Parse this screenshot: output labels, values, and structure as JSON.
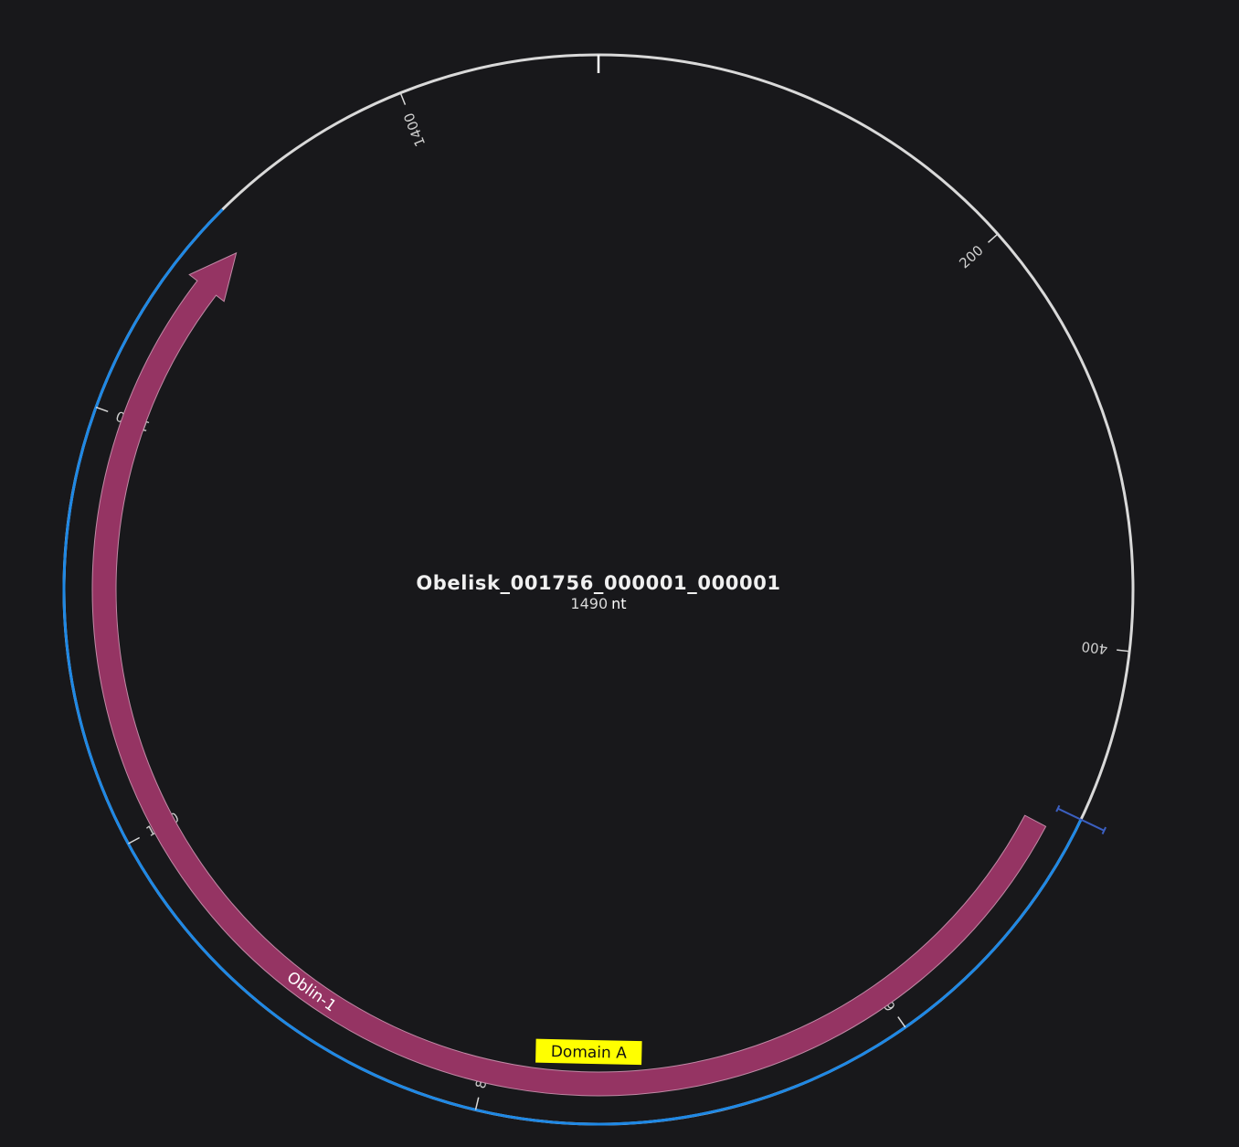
{
  "sequence": {
    "name": "Obelisk_001756_000001_000001",
    "length_value": "1490",
    "length_unit": "nt",
    "length": 1490
  },
  "ticks": [
    {
      "position": 200,
      "label": "200"
    },
    {
      "position": 400,
      "label": "400"
    },
    {
      "position": 600,
      "label": "600"
    },
    {
      "position": 800,
      "label": "800"
    },
    {
      "position": 1000,
      "label": "1000"
    },
    {
      "position": 1200,
      "label": "1200"
    },
    {
      "position": 1400,
      "label": "1400"
    }
  ],
  "features": [
    {
      "name": "Oblin-1",
      "start": 488,
      "end": 1295,
      "direction": "reverse",
      "color": "#953463"
    }
  ],
  "annotations": [
    {
      "name": "Domain A",
      "position": 750,
      "color": "#ffff00"
    }
  ],
  "selection": {
    "start": 478,
    "end": 1305,
    "color": "#1e88e5"
  },
  "cursor": {
    "position": 478,
    "color": "#3b5fc0"
  },
  "colors": {
    "background": "#18181b",
    "backbone": "#d9d9d9",
    "text": "#e6e6e6"
  }
}
